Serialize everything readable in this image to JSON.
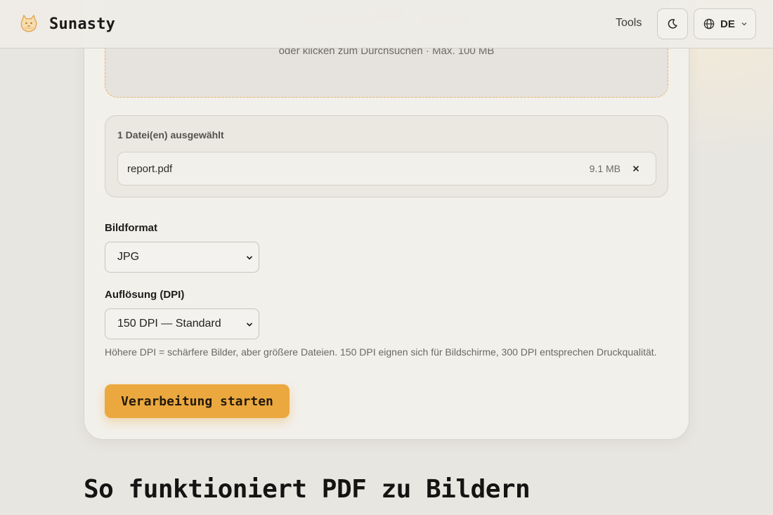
{
  "header": {
    "brand_name": "Sunasty",
    "brand_logo_icon": "cat-logo-icon",
    "nav_tools": "Tools",
    "theme_toggle_icon": "moon-icon",
    "language": {
      "icon": "globe-icon",
      "label": "DE",
      "chevron_icon": "chevron-down-icon"
    }
  },
  "upload": {
    "hint": "oder klicken zum Durchsuchen · Max. 100 MB"
  },
  "files": {
    "count_label": "1 Datei(en) ausgewählt",
    "items": [
      {
        "name": "report.pdf",
        "size": "9.1 MB",
        "remove_icon": "close-icon"
      }
    ]
  },
  "options": {
    "format": {
      "label": "Bildformat",
      "value": "JPG"
    },
    "dpi": {
      "label": "Auflösung (DPI)",
      "value": "150 DPI — Standard",
      "help": "Höhere DPI = schärfere Bilder, aber größere Dateien. 150 DPI eignen sich für Bildschirme, 300 DPI entsprechen Druckqualität."
    }
  },
  "actions": {
    "start_label": "Verarbeitung starten"
  },
  "section": {
    "title": "So funktioniert PDF zu Bildern"
  },
  "colors": {
    "accent": "#eba83f",
    "dropzone_border": "#e9b569",
    "background": "#e8e6e1",
    "card": "#f2f0eb"
  }
}
